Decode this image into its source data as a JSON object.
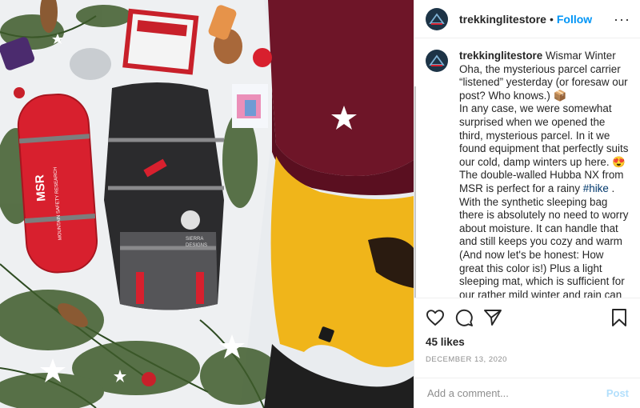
{
  "post": {
    "username": "trekkinglitestore",
    "dot": "•",
    "follow_label": "Follow",
    "more_label": "···",
    "caption": {
      "username": "trekkinglitestore",
      "text_before_tag": " Wismar Winter\nOha, the mysterious parcel carrier “listened” yesterday (or foresaw our post? Who knows.) 📦\nIn any case, we were somewhat surprised when we opened the third, mysterious parcel. In it we found equipment that perfectly suits our cold, damp winters up here. 😍\nThe double-walled Hubba NX from MSR is perfect for a rainy ",
      "hashtag": "#hike",
      "text_after_tag": " .\nWith the synthetic sleeping bag there is absolutely no need to worry about moisture. It can handle that and still keeps you cozy and warm (And now let's be honest: How great this color is!) Plus a light sleeping mat, which is sufficient for our rather mild winter and rain can no longer stop us!\n\nA        f   t      #Ub    i   ttl"
    },
    "likes": "45 likes",
    "date": "DECEMBER 13, 2020",
    "comment_placeholder": "Add a comment...",
    "post_button": "Post",
    "product_text": {
      "tent_brand": "MSR",
      "tent_line1": "MOUNTAIN SAFETY RESEARCH",
      "pack_brand": "SIERRA",
      "pack_brand2": "DESIGNS"
    },
    "colors": {
      "accent": "#0095f6",
      "tag": "#00376b",
      "post_disabled": "#b2dffc",
      "meta": "#8e8e8e"
    }
  }
}
